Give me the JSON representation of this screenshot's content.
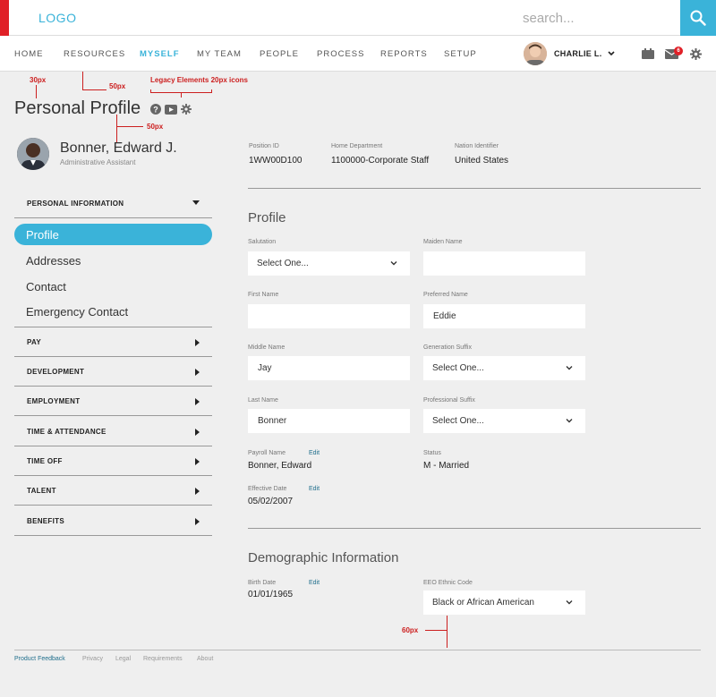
{
  "header": {
    "logo": "LOGO",
    "search_placeholder": "search...",
    "accent": "#3ab3d9",
    "brand_red": "#e02027"
  },
  "nav": {
    "items": [
      "HOME",
      "RESOURCES",
      "MYSELF",
      "MY TEAM",
      "PEOPLE",
      "PROCESS",
      "REPORTS",
      "SETUP"
    ],
    "active": "MYSELF",
    "user_name": "CHARLIE L.",
    "mail_count": "6"
  },
  "annotations": {
    "a30": "30px",
    "a50top": "50px",
    "legacy": "Legacy Elements 20px icons",
    "a50bottom": "50px",
    "a60": "60px"
  },
  "page": {
    "title": "Personal Profile",
    "person_name": "Bonner, Edward J.",
    "person_role": "Administrative Assistant"
  },
  "sidebar": {
    "personal_information": "PERSONAL INFORMATION",
    "subitems": [
      "Profile",
      "Addresses",
      "Contact",
      "Emergency Contact"
    ],
    "sections": [
      "PAY",
      "DEVELOPMENT",
      "EMPLOYMENT",
      "TIME & ATTENDANCE",
      "TIME OFF",
      "TALENT",
      "BENEFITS"
    ]
  },
  "meta": {
    "position_id_label": "Position ID",
    "position_id": "1WW00D100",
    "home_dept_label": "Home Department",
    "home_dept": "1100000-Corporate Staff",
    "nation_label": "Nation Identifier",
    "nation": "United States"
  },
  "profile": {
    "title": "Profile",
    "salutation_label": "Salutation",
    "salutation": "Select One...",
    "maiden_label": "Maiden Name",
    "maiden": "",
    "first_label": "First Name",
    "first": "",
    "preferred_label": "Preferred Name",
    "preferred": "Eddie",
    "middle_label": "Middle Name",
    "middle": "Jay",
    "gen_suffix_label": "Generation Suffix",
    "gen_suffix": "Select One...",
    "last_label": "Last Name",
    "last": "Bonner",
    "prof_suffix_label": "Professional Suffix",
    "prof_suffix": "Select One...",
    "payroll_label": "Payroll Name",
    "payroll": "Bonner, Edward",
    "status_label": "Status",
    "status": "M - Married",
    "effective_label": "Effective Date",
    "effective": "05/02/2007",
    "edit": "Edit"
  },
  "demographic": {
    "title": "Demographic Information",
    "birth_label": "Birth Date",
    "birth": "01/01/1965",
    "eeo_label": "EEO Ethnic Code",
    "eeo": "Black or African American",
    "edit": "Edit"
  },
  "footer": {
    "links": [
      "Product Feedback",
      "Privacy",
      "Legal",
      "Requirements",
      "About"
    ]
  }
}
